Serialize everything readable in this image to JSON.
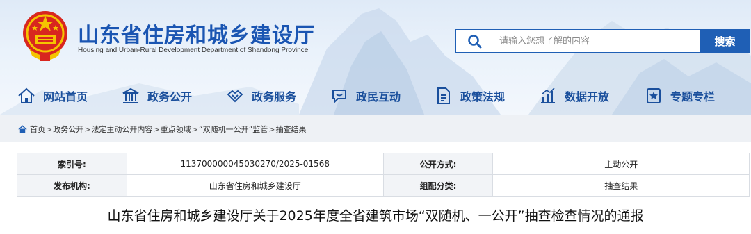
{
  "header": {
    "title": "山东省住房和城乡建设厅",
    "subtitle": "Housing and Urban-Rural Development Department of Shandong Province",
    "emblem_icon": "national-emblem-icon",
    "accent_color": "#1f5fb5"
  },
  "search": {
    "placeholder": "请输入您想了解的内容",
    "button_label": "搜索"
  },
  "nav": {
    "items": [
      {
        "label": "网站首页",
        "icon": "home-icon"
      },
      {
        "label": "政务公开",
        "icon": "building-icon"
      },
      {
        "label": "政务服务",
        "icon": "handshake-icon"
      },
      {
        "label": "政民互动",
        "icon": "chat-icon"
      },
      {
        "label": "政策法规",
        "icon": "document-icon"
      },
      {
        "label": "数据开放",
        "icon": "chart-icon"
      },
      {
        "label": "专题专栏",
        "icon": "star-badge-icon"
      }
    ]
  },
  "breadcrumb": {
    "items": [
      "首页",
      "政务公开",
      "法定主动公开内容",
      "重点领域",
      "“双随机一公开”监管",
      "抽查结果"
    ],
    "separator": ">"
  },
  "meta": {
    "index_label": "索引号:",
    "index_value": "113700000045030270/2025-01568",
    "method_label": "公开方式:",
    "method_value": "主动公开",
    "publisher_label": "发布机构:",
    "publisher_value": "山东省住房和城乡建设厅",
    "category_label": "组配分类:",
    "category_value": "抽查结果"
  },
  "document": {
    "title": "山东省住房和城乡建设厅关于2025年度全省建筑市场“双随机、一公开”抽查检查情况的通报"
  }
}
